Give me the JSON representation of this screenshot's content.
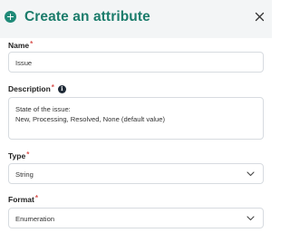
{
  "header": {
    "title": "Create an attribute"
  },
  "fields": {
    "name": {
      "label": "Name",
      "required_mark": "*",
      "value": "Issue"
    },
    "description": {
      "label": "Description",
      "required_mark": "*",
      "info": "i",
      "value": "State of the issue:\nNew, Processing, Resolved, None (default value)"
    },
    "type": {
      "label": "Type",
      "required_mark": "*",
      "value": "String"
    },
    "format": {
      "label": "Format",
      "required_mark": "*",
      "value": "Enumeration"
    }
  },
  "colors": {
    "accent": "#1b7c6b",
    "required": "#d9534f",
    "header_bg": "#f3f5f6",
    "border": "#d7dbe0"
  },
  "icons": {
    "header": "plus-circle-icon",
    "close": "close-icon",
    "info": "info-icon",
    "select": "chevron-down-icon"
  }
}
